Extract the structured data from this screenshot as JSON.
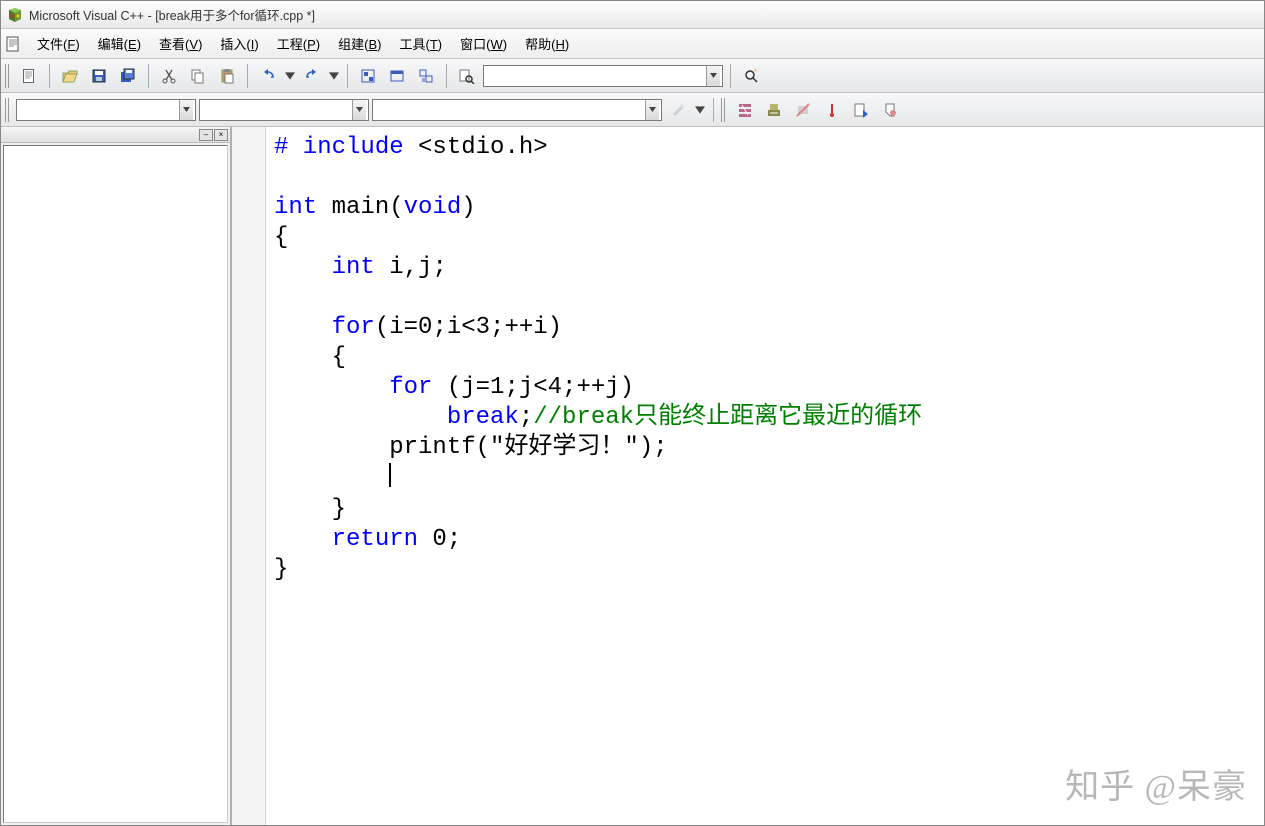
{
  "title": "Microsoft Visual C++ - [break用于多个for循环.cpp *]",
  "menu": {
    "file": {
      "label": "文件",
      "mn": "F"
    },
    "edit": {
      "label": "编辑",
      "mn": "E"
    },
    "view": {
      "label": "查看",
      "mn": "V"
    },
    "insert": {
      "label": "插入",
      "mn": "I"
    },
    "project": {
      "label": "工程",
      "mn": "P"
    },
    "build": {
      "label": "组建",
      "mn": "B"
    },
    "tools": {
      "label": "工具",
      "mn": "T"
    },
    "window": {
      "label": "窗口",
      "mn": "W"
    },
    "help": {
      "label": "帮助",
      "mn": "H"
    }
  },
  "code": {
    "lines": [
      [
        {
          "t": "# include",
          "c": "pp"
        },
        {
          "t": " <stdio.h>"
        }
      ],
      [
        {
          "t": ""
        }
      ],
      [
        {
          "t": "int",
          "c": "kw"
        },
        {
          "t": " main("
        },
        {
          "t": "void",
          "c": "kw"
        },
        {
          "t": ")"
        }
      ],
      [
        {
          "t": "{"
        }
      ],
      [
        {
          "t": "    "
        },
        {
          "t": "int",
          "c": "kw"
        },
        {
          "t": " i,j;"
        }
      ],
      [
        {
          "t": ""
        }
      ],
      [
        {
          "t": "    "
        },
        {
          "t": "for",
          "c": "kw"
        },
        {
          "t": "(i=0;i<3;++i)"
        }
      ],
      [
        {
          "t": "    {"
        }
      ],
      [
        {
          "t": "        "
        },
        {
          "t": "for",
          "c": "kw"
        },
        {
          "t": " (j=1;j<4;++j)"
        }
      ],
      [
        {
          "t": "            "
        },
        {
          "t": "break",
          "c": "kw"
        },
        {
          "t": ";"
        },
        {
          "t": "//break只能终止距离它最近的循环",
          "c": "cm"
        }
      ],
      [
        {
          "t": "        printf(\"好好学习！\");"
        }
      ],
      [
        {
          "t": "        "
        },
        {
          "caret": true
        }
      ],
      [
        {
          "t": "    }"
        }
      ],
      [
        {
          "t": "    "
        },
        {
          "t": "return",
          "c": "kw"
        },
        {
          "t": " 0;"
        }
      ],
      [
        {
          "t": "}"
        }
      ]
    ]
  },
  "watermark": "知乎 @呆豪"
}
